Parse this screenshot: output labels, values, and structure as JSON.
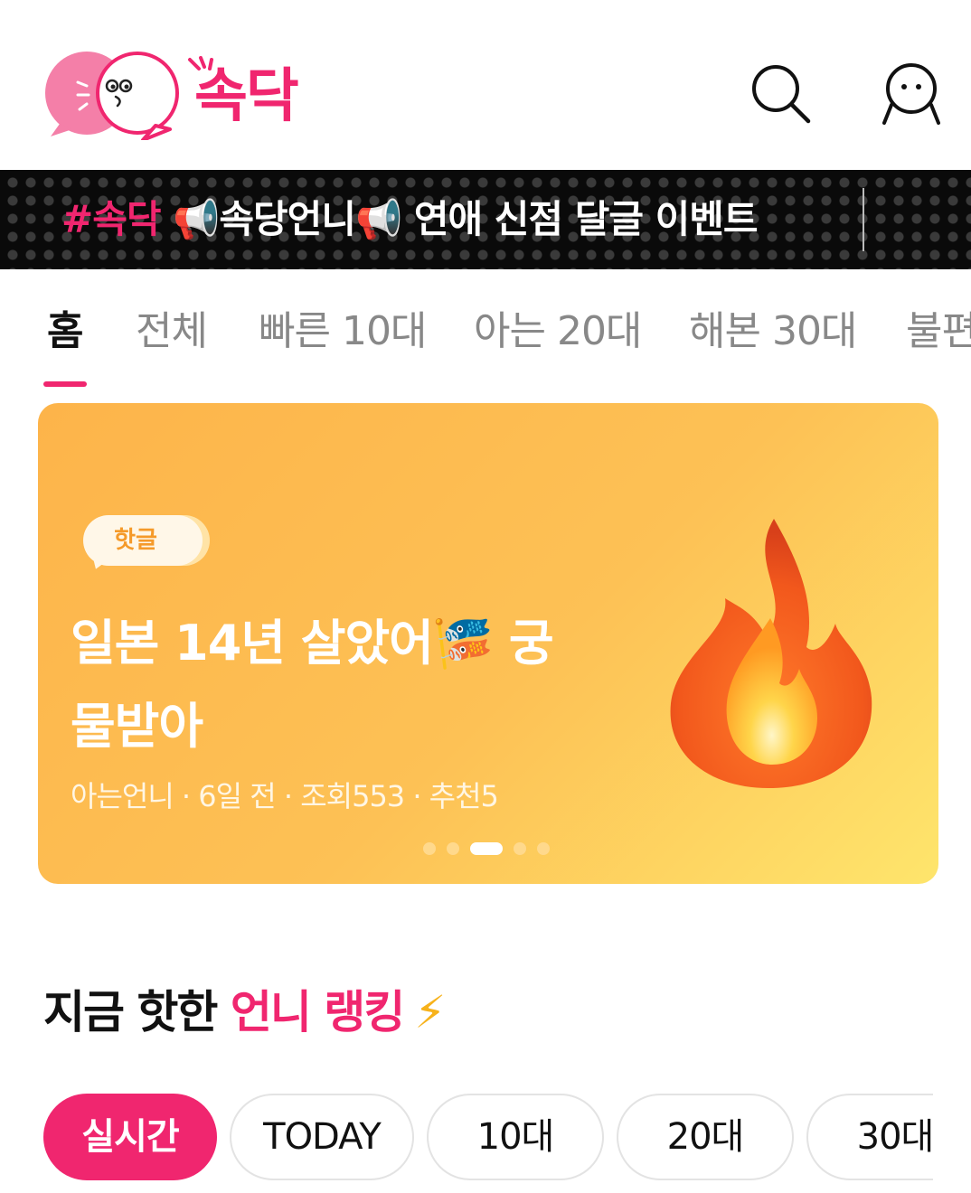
{
  "brand": {
    "logo_text": "속닥",
    "accent_color": "#f0266f"
  },
  "header": {
    "search_icon": "search-icon",
    "profile_icon": "profile-icon"
  },
  "ticker": {
    "hashtag": "#속닥",
    "emoji1": "📢",
    "text1": "속당언니",
    "emoji2": "📢",
    "text2": " 연애 신점 달글 이벤트"
  },
  "tabs": [
    {
      "label": "홈",
      "active": true
    },
    {
      "label": "전체"
    },
    {
      "label": "빠른 10대"
    },
    {
      "label": "아는 20대"
    },
    {
      "label": "해본 30대"
    },
    {
      "label": "불편"
    }
  ],
  "hero": {
    "badge": "핫글",
    "title_line1_a": "일본 14년 살았어",
    "title_emoji": "🎏",
    "title_line1_b": " 궁",
    "title_line2": "물받아",
    "meta": "아는언니 · 6일 전 · 조회553 · 추천5",
    "image_icon": "fire-icon",
    "slide_current": 3,
    "slide_total": 5
  },
  "ranking": {
    "title_prefix": "지금 핫한 ",
    "title_accent": "언니 랭킹",
    "title_emoji": "⚡",
    "filters": [
      {
        "label": "실시간",
        "active": true
      },
      {
        "label": "TODAY"
      },
      {
        "label": "10대"
      },
      {
        "label": "20대"
      },
      {
        "label": "30대"
      }
    ]
  }
}
